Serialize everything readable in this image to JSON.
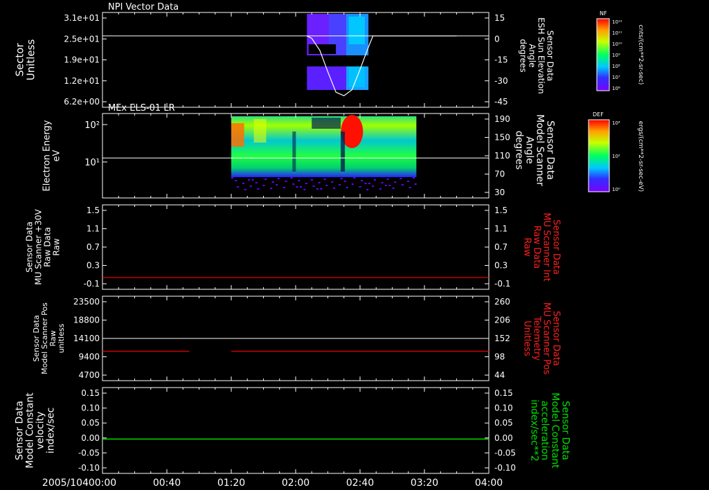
{
  "chart_data": [
    {
      "type": "heatmap",
      "title": "NPI Vector Data",
      "ylabel_left": [
        "Sector",
        "Unitless"
      ],
      "yticks_left": [
        "3.1e+01",
        "2.5e+01",
        "1.9e+01",
        "1.2e+01",
        "6.2e+00"
      ],
      "ylabel_right": [
        "Sensor Data",
        "ESH Sun Elevation",
        "Angle",
        "degrees"
      ],
      "yticks_right": [
        "15",
        "0",
        "-15",
        "-30",
        "-45"
      ],
      "yright_lim": [
        15,
        -55
      ],
      "reference_line": 0,
      "series": [
        {
          "color": "#ffffff",
          "x": [
            "02:07",
            "02:10",
            "02:15",
            "02:20",
            "02:25",
            "02:30",
            "02:35",
            "02:40",
            "02:45",
            "02:48",
            "02:50",
            "03:40"
          ],
          "y": [
            0,
            -2,
            -12,
            -30,
            -47,
            -50,
            -45,
            -28,
            -10,
            0,
            0,
            0
          ]
        }
      ],
      "colorbar": {
        "label": "NF",
        "units": "cnts/(cm**2-sr-sec)",
        "ticks": [
          "10¹²",
          "10¹¹",
          "10¹⁰",
          "10⁹",
          "10⁸",
          "10⁷",
          "10⁶"
        ]
      }
    },
    {
      "type": "heatmap",
      "title": "MEx ELS-01 LR",
      "ylabel_left": [
        "Electron Energy",
        "eV"
      ],
      "yticks_left": [
        "10²",
        "10¹"
      ],
      "ylabel_right": [
        "Sensor Data",
        "Model Scanner",
        "Angle",
        "degrees"
      ],
      "yticks_right": [
        "190",
        "150",
        "110",
        "70",
        "30"
      ],
      "yright_lim": [
        0,
        190
      ],
      "reference_line": 90,
      "colorbar": {
        "label": "DEF",
        "units": "ergs/(cm**2-sr-sec-eV)",
        "ticks": [
          "10⁴",
          "10²",
          "10⁰"
        ]
      }
    },
    {
      "type": "line",
      "ylabel_left": [
        "Sensor Data",
        "MU Scanner +30V",
        "Raw Data",
        "Raw"
      ],
      "yticks_left": [
        "1.5",
        "1.1",
        "0.7",
        "0.3",
        "-0.1"
      ],
      "ylabel_right": [
        "Sensor Data",
        "MU Scanner Int",
        "Raw Data",
        "Raw"
      ],
      "yticks_right": [
        "1.5",
        "1.1",
        "0.7",
        "0.3",
        "-0.1"
      ],
      "ylim": [
        -0.3,
        1.5
      ],
      "series": [
        {
          "color": "#ff0000",
          "x": [
            "00:00",
            "04:00"
          ],
          "y": [
            -0.05,
            -0.05
          ]
        }
      ]
    },
    {
      "type": "line",
      "ylabel_left": [
        "Sensor Data",
        "Model Scanner Pos",
        "Raw",
        "unitless"
      ],
      "yticks_left": [
        "23500",
        "18800",
        "14100",
        "9400",
        "4700"
      ],
      "ylabel_right": [
        "Sensor Data",
        "MU Scanner Pos",
        "Telemetry",
        "Unitless"
      ],
      "yticks_right": [
        "260",
        "206",
        "152",
        "98",
        "44"
      ],
      "ylim": [
        0,
        23500
      ],
      "reference_line": 11750,
      "series": [
        {
          "color": "#ff0000",
          "x": [
            "00:00",
            "00:54"
          ],
          "y": [
            8200,
            8200
          ]
        },
        {
          "color": "#ff0000",
          "x": [
            "01:20",
            "04:00"
          ],
          "y": [
            8200,
            8200
          ]
        }
      ]
    },
    {
      "type": "line",
      "ylabel_left": [
        "Sensor Data",
        "Model Constant",
        "velocity",
        "index/sec"
      ],
      "yticks_left": [
        "0.15",
        "0.10",
        "0.05",
        "0.00",
        "-0.05",
        "-0.10"
      ],
      "ylabel_right": [
        "Sensor Data",
        "Model Constant",
        "acceleration",
        "index/sec**2"
      ],
      "yticks_right": [
        "0.15",
        "0.10",
        "0.05",
        "0.00",
        "-0.05",
        "-0.10"
      ],
      "ylim": [
        -0.1,
        0.15
      ],
      "series": [
        {
          "color": "#00ff00",
          "x": [
            "00:00",
            "04:00"
          ],
          "y": [
            0,
            0
          ]
        }
      ]
    }
  ],
  "xaxis": {
    "date": "2005/104",
    "ticks": [
      "00:00",
      "00:40",
      "01:20",
      "02:00",
      "02:40",
      "03:20",
      "04:00"
    ]
  }
}
